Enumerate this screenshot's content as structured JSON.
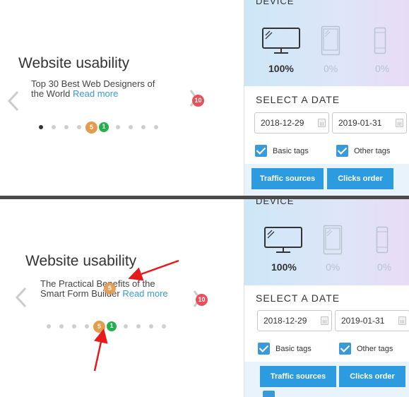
{
  "top": {
    "slide": {
      "title": "Website usability",
      "text_lines": [
        "Top 30 Best Web Designers of",
        "the World"
      ],
      "read_more": "Read more"
    },
    "badges": {
      "red": "10",
      "orange": "5",
      "green": "1"
    },
    "device": {
      "label": "DEVICE",
      "options": [
        {
          "name": "desktop",
          "percent": "100%",
          "active": true
        },
        {
          "name": "tablet",
          "percent": "0%",
          "active": false
        },
        {
          "name": "mobile",
          "percent": "0%",
          "active": false
        }
      ]
    },
    "select_date": {
      "label": "SELECT A DATE",
      "start": "2018-12-29",
      "end": "2019-01-31"
    },
    "checkboxes": {
      "basic": "Basic tags",
      "other": "Other tags"
    },
    "buttons": {
      "traffic": "Traffic sources",
      "clicks": "Clicks order"
    }
  },
  "bottom": {
    "slide": {
      "title": "Website usability",
      "text_lines": [
        "The Practical Benefits of the",
        "Smart Form Builder"
      ],
      "read_more": "Read more"
    },
    "badges": {
      "red": "10",
      "orange_text": "5",
      "orange_dots": "5",
      "green": "1"
    },
    "device": {
      "label": "DEVICE",
      "options": [
        {
          "name": "desktop",
          "percent": "100%",
          "active": true
        },
        {
          "name": "tablet",
          "percent": "0%",
          "active": false
        },
        {
          "name": "mobile",
          "percent": "0%",
          "active": false
        }
      ]
    },
    "select_date": {
      "label": "SELECT A DATE",
      "start": "2018-12-29",
      "end": "2019-01-31"
    },
    "checkboxes": {
      "basic": "Basic tags",
      "other": "Other tags"
    },
    "buttons": {
      "traffic": "Traffic sources",
      "clicks": "Clicks order"
    }
  },
  "colors": {
    "accent_blue": "#2d9be0",
    "badge_red": "#e9505a",
    "badge_orange": "#e59b4e",
    "badge_green": "#22b14c",
    "annotation_red": "#e8191b"
  },
  "icons": [
    "chevron-left-icon",
    "chevron-right-icon",
    "desktop-icon",
    "tablet-icon",
    "mobile-icon",
    "calendar-icon",
    "checkmark-icon"
  ]
}
